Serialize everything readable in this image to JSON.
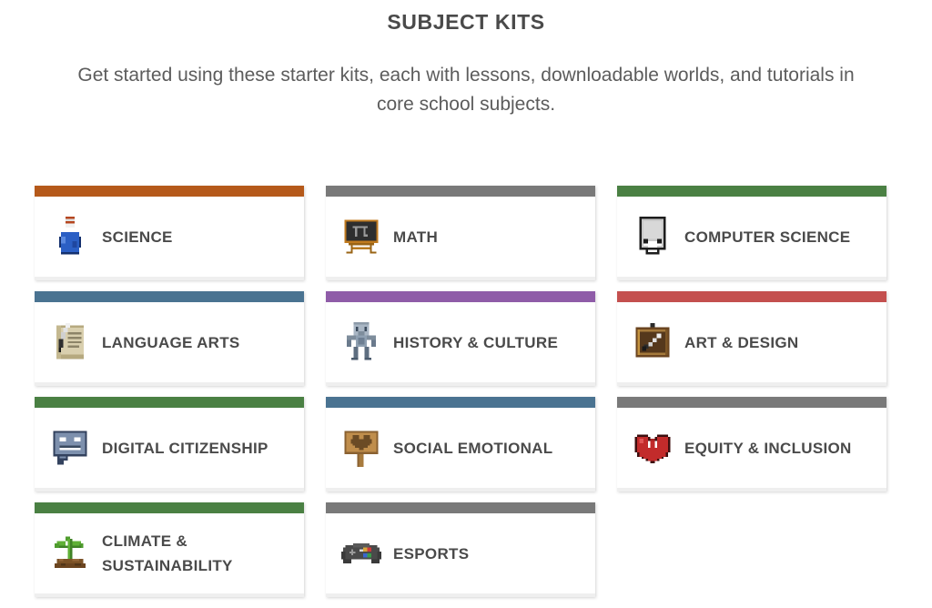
{
  "header": {
    "title": "SUBJECT KITS",
    "subtitle": "Get started using these starter kits, each with lessons, downloadable worlds, and tutorials in core school subjects."
  },
  "palette": {
    "rust": "#b5591a",
    "gray": "#797979",
    "green": "#4a8043",
    "steel_blue": "#4a7391",
    "purple": "#8f5ca8",
    "red": "#c4504f",
    "blue": "#4a7391",
    "text": "#4a4a4a",
    "card_bg": "#ffffff",
    "page_bg": "#ffffff"
  },
  "cards": [
    {
      "label": "SCIENCE",
      "bar_color": "#b5591a",
      "icon": "potion-bottle-icon"
    },
    {
      "label": "MATH",
      "bar_color": "#797979",
      "icon": "blackboard-icon"
    },
    {
      "label": "COMPUTER SCIENCE",
      "bar_color": "#4a8043",
      "icon": "ghast-face-icon"
    },
    {
      "label": "LANGUAGE ARTS",
      "bar_color": "#4a7391",
      "icon": "book-and-quill-icon"
    },
    {
      "label": "HISTORY & CULTURE",
      "bar_color": "#8f5ca8",
      "icon": "iron-golem-icon"
    },
    {
      "label": "ART & DESIGN",
      "bar_color": "#c4504f",
      "icon": "framed-painting-icon"
    },
    {
      "label": "DIGITAL CITIZENSHIP",
      "bar_color": "#4a8043",
      "icon": "chat-bubble-face-icon"
    },
    {
      "label": "SOCIAL EMOTIONAL",
      "bar_color": "#4a7391",
      "icon": "heart-sign-icon"
    },
    {
      "label": "EQUITY & INCLUSION",
      "bar_color": "#797979",
      "icon": "red-heart-icon"
    },
    {
      "label": "CLIMATE &\nSUSTAINABILITY",
      "bar_color": "#4a8043",
      "icon": "sapling-icon"
    },
    {
      "label": "ESPORTS",
      "bar_color": "#797979",
      "icon": "game-controller-icon"
    }
  ]
}
